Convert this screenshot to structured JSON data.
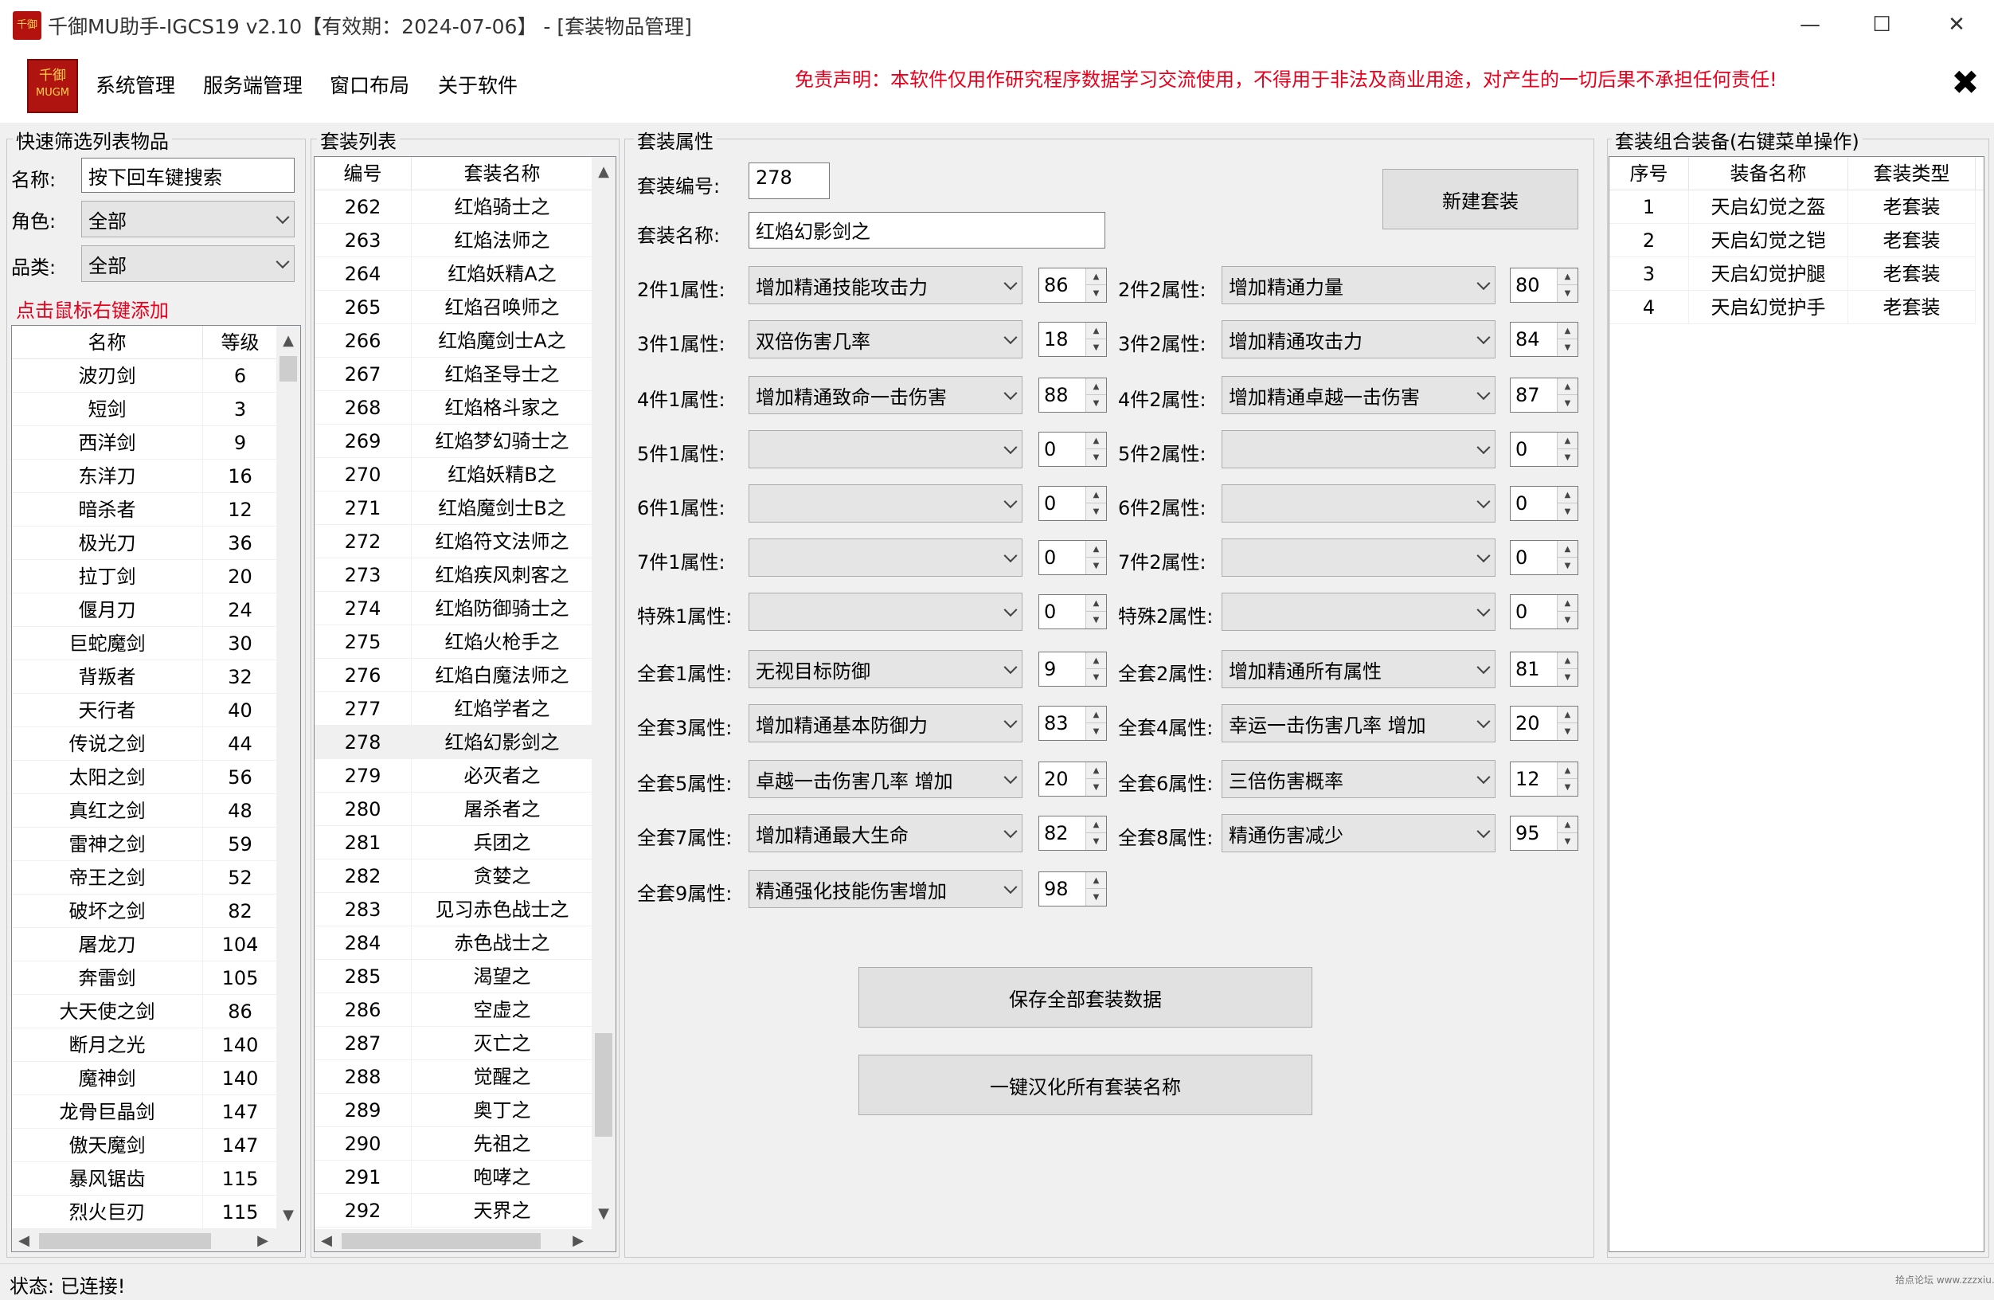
{
  "window": {
    "title": "千御MU助手-IGCS19 v2.10【有效期：2024-07-06】 - [套装物品管理]",
    "icon_text": "千御",
    "minimize": "—",
    "maximize": "☐",
    "close": "✕"
  },
  "menu": {
    "logo_text_1": "千御",
    "logo_text_2": "MUGM",
    "items": [
      "系统管理",
      "服务端管理",
      "窗口布局",
      "关于软件"
    ],
    "disclaimer": "免责声明：本软件仅用作研究程序数据学习交流使用，不得用于非法及商业用途，对产生的一切后果不承担任何责任!",
    "close_x": "✖"
  },
  "filter": {
    "group_title": "快速筛选列表物品",
    "name_label": "名称:",
    "name_value": "按下回车键搜索",
    "role_label": "角色:",
    "role_value": "全部",
    "category_label": "品类:",
    "category_value": "全部",
    "hint": "点击鼠标右键添加",
    "columns": [
      "名称",
      "等级"
    ],
    "rows": [
      [
        "波刃剑",
        "6"
      ],
      [
        "短剑",
        "3"
      ],
      [
        "西洋剑",
        "9"
      ],
      [
        "东洋刀",
        "16"
      ],
      [
        "暗杀者",
        "12"
      ],
      [
        "极光刀",
        "36"
      ],
      [
        "拉丁剑",
        "20"
      ],
      [
        "偃月刀",
        "24"
      ],
      [
        "巨蛇魔剑",
        "30"
      ],
      [
        "背叛者",
        "32"
      ],
      [
        "天行者",
        "40"
      ],
      [
        "传说之剑",
        "44"
      ],
      [
        "太阳之剑",
        "56"
      ],
      [
        "真红之剑",
        "48"
      ],
      [
        "雷神之剑",
        "59"
      ],
      [
        "帝王之剑",
        "52"
      ],
      [
        "破坏之剑",
        "82"
      ],
      [
        "屠龙刀",
        "104"
      ],
      [
        "奔雷剑",
        "105"
      ],
      [
        "大天使之剑",
        "86"
      ],
      [
        "断月之光",
        "140"
      ],
      [
        "魔神剑",
        "140"
      ],
      [
        "龙骨巨晶剑",
        "147"
      ],
      [
        "傲天魔剑",
        "147"
      ],
      [
        "暴风锯齿",
        "115"
      ],
      [
        "烈火巨刃",
        "115"
      ]
    ]
  },
  "setlist": {
    "group_title": "套装列表",
    "columns": [
      "编号",
      "套装名称"
    ],
    "rows": [
      [
        "262",
        "红焰骑士之"
      ],
      [
        "263",
        "红焰法师之"
      ],
      [
        "264",
        "红焰妖精A之"
      ],
      [
        "265",
        "红焰召唤师之"
      ],
      [
        "266",
        "红焰魔剑士A之"
      ],
      [
        "267",
        "红焰圣导士之"
      ],
      [
        "268",
        "红焰格斗家之"
      ],
      [
        "269",
        "红焰梦幻骑士之"
      ],
      [
        "270",
        "红焰妖精B之"
      ],
      [
        "271",
        "红焰魔剑士B之"
      ],
      [
        "272",
        "红焰符文法师之"
      ],
      [
        "273",
        "红焰疾风刺客之"
      ],
      [
        "274",
        "红焰防御骑士之"
      ],
      [
        "275",
        "红焰火枪手之"
      ],
      [
        "276",
        "红焰白魔法师之"
      ],
      [
        "277",
        "红焰学者之"
      ],
      [
        "278",
        "红焰幻影剑之"
      ],
      [
        "279",
        "必灭者之"
      ],
      [
        "280",
        "屠杀者之"
      ],
      [
        "281",
        "兵团之"
      ],
      [
        "282",
        "贪婪之"
      ],
      [
        "283",
        "见习赤色战士之"
      ],
      [
        "284",
        "赤色战士之"
      ],
      [
        "285",
        "渴望之"
      ],
      [
        "286",
        "空虚之"
      ],
      [
        "287",
        "灭亡之"
      ],
      [
        "288",
        "觉醒之"
      ],
      [
        "289",
        "奥丁之"
      ],
      [
        "290",
        "先祖之"
      ],
      [
        "291",
        "咆哮之"
      ],
      [
        "292",
        "天界之"
      ]
    ],
    "selected_index": 16
  },
  "props": {
    "group_title": "套装属性",
    "set_id_label": "套装编号:",
    "set_id_value": "278",
    "set_name_label": "套装名称:",
    "set_name_value": "红焰幻影剑之",
    "new_button": "新建套装",
    "left": [
      {
        "label": "2件1属性:",
        "value": "增加精通技能攻击力",
        "num": "86"
      },
      {
        "label": "3件1属性:",
        "value": "双倍伤害几率",
        "num": "18"
      },
      {
        "label": "4件1属性:",
        "value": "增加精通致命一击伤害",
        "num": "88"
      },
      {
        "label": "5件1属性:",
        "value": "",
        "num": "0"
      },
      {
        "label": "6件1属性:",
        "value": "",
        "num": "0"
      },
      {
        "label": "7件1属性:",
        "value": "",
        "num": "0"
      },
      {
        "label": "特殊1属性:",
        "value": "",
        "num": "0"
      },
      {
        "label": "全套1属性:",
        "value": "无视目标防御",
        "num": "9"
      },
      {
        "label": "全套3属性:",
        "value": "增加精通基本防御力",
        "num": "83"
      },
      {
        "label": "全套5属性:",
        "value": "卓越一击伤害几率 增加",
        "num": "20"
      },
      {
        "label": "全套7属性:",
        "value": "增加精通最大生命",
        "num": "82"
      },
      {
        "label": "全套9属性:",
        "value": "精通强化技能伤害增加",
        "num": "98"
      }
    ],
    "right": [
      {
        "label": "2件2属性:",
        "value": "增加精通力量",
        "num": "80"
      },
      {
        "label": "3件2属性:",
        "value": "增加精通攻击力",
        "num": "84"
      },
      {
        "label": "4件2属性:",
        "value": "增加精通卓越一击伤害",
        "num": "87"
      },
      {
        "label": "5件2属性:",
        "value": "",
        "num": "0"
      },
      {
        "label": "6件2属性:",
        "value": "",
        "num": "0"
      },
      {
        "label": "7件2属性:",
        "value": "",
        "num": "0"
      },
      {
        "label": "特殊2属性:",
        "value": "",
        "num": "0"
      },
      {
        "label": "全套2属性:",
        "value": "增加精通所有属性",
        "num": "81"
      },
      {
        "label": "全套4属性:",
        "value": "幸运一击伤害几率 增加",
        "num": "20"
      },
      {
        "label": "全套6属性:",
        "value": "三倍伤害概率",
        "num": "12"
      },
      {
        "label": "全套8属性:",
        "value": "精通伤害减少",
        "num": "95"
      }
    ],
    "save_button": "保存全部套装数据",
    "localize_button": "一键汉化所有套装名称"
  },
  "combo": {
    "group_title": "套装组合装备(右键菜单操作)",
    "columns": [
      "序号",
      "装备名称",
      "套装类型"
    ],
    "rows": [
      [
        "1",
        "天启幻觉之盔",
        "老套装"
      ],
      [
        "2",
        "天启幻觉之铠",
        "老套装"
      ],
      [
        "3",
        "天启幻觉护腿",
        "老套装"
      ],
      [
        "4",
        "天启幻觉护手",
        "老套装"
      ]
    ]
  },
  "status": {
    "text": "状态:  已连接!",
    "watermark": "拾点论坛 www.zzzxiu.com"
  }
}
